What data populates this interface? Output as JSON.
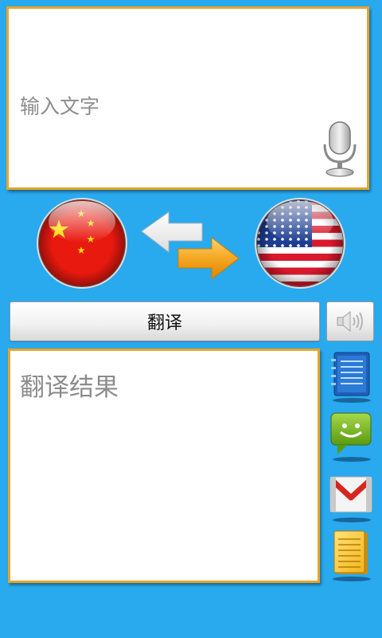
{
  "input": {
    "placeholder": "输入文字"
  },
  "languages": {
    "source": "china-flag-icon",
    "target": "usa-flag-icon",
    "swap": "swap-arrows-icon"
  },
  "translate": {
    "label": "翻译"
  },
  "result": {
    "placeholder": "翻译结果"
  },
  "side_actions": [
    {
      "icon": "notes-icon"
    },
    {
      "icon": "sms-icon"
    },
    {
      "icon": "mail-icon"
    },
    {
      "icon": "notepad-icon"
    }
  ],
  "colors": {
    "background": "#29a9ee",
    "border": "#e8a52a",
    "accent": "#f0a21c"
  }
}
